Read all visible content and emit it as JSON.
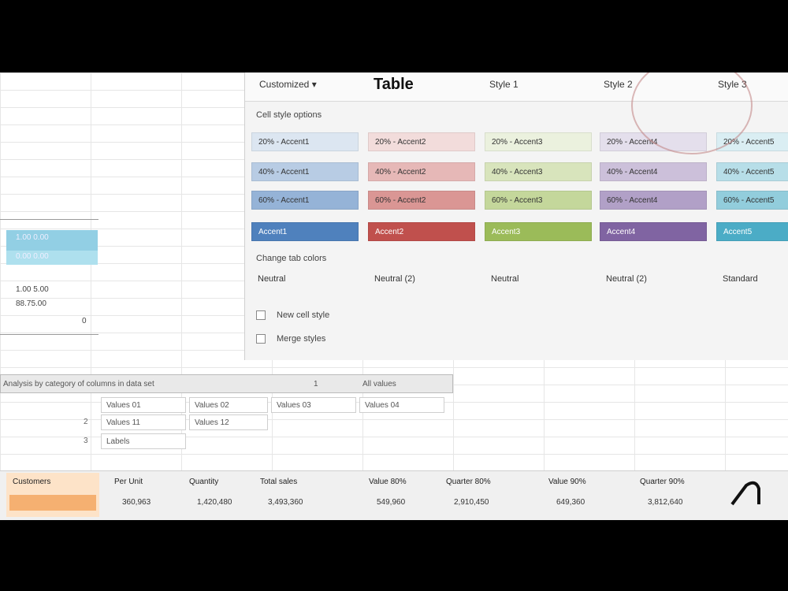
{
  "gallery": {
    "tabs": [
      "Customized ▾",
      "Table",
      "Style 1",
      "Style 2",
      "Style 3"
    ],
    "section1": "Cell style options",
    "section2": "Change tab colors",
    "swatch_rows": [
      [
        "20% - Accent1",
        "20% - Accent2",
        "20% - Accent3",
        "20% - Accent4",
        "20% - Accent5"
      ],
      [
        "40% - Accent1",
        "40% - Accent2",
        "40% - Accent3",
        "40% - Accent4",
        "40% - Accent5"
      ],
      [
        "60% - Accent1",
        "60% - Accent2",
        "60% - Accent3",
        "60% - Accent4",
        "60% - Accent5"
      ],
      [
        "Accent1",
        "Accent2",
        "Accent3",
        "Accent4",
        "Accent5"
      ]
    ],
    "plain_row": [
      "Neutral",
      "Neutral (2)",
      "Neutral",
      "Neutral (2)",
      "Standard"
    ],
    "options": [
      "New cell style",
      "Merge styles"
    ],
    "colors": {
      "r1": [
        "#dce6f1",
        "#f2dcdb",
        "#ebf1de",
        "#e4dfec",
        "#daeef3"
      ],
      "r2": [
        "#b8cce4",
        "#e6b8b7",
        "#d8e4bc",
        "#ccc0da",
        "#b7dee8"
      ],
      "r3": [
        "#95b3d7",
        "#da9694",
        "#c4d79b",
        "#b1a0c7",
        "#92cddc"
      ],
      "r4": [
        "#4f81bd",
        "#c0504d",
        "#9bbb59",
        "#8064a2",
        "#4bacc6"
      ]
    }
  },
  "mini": {
    "lines": [
      "1.00 0.00",
      "0.00 0.00",
      "1.00 5.00",
      "88.75.00",
      "0"
    ]
  },
  "table": {
    "header": [
      "Analysis by category of columns in data set",
      "1",
      "All values"
    ],
    "rows": [
      [
        "Values 01",
        "Values 02",
        "Values 03",
        "Values 04"
      ],
      [
        "Values 11",
        "Values 12"
      ],
      [
        "Labels"
      ]
    ],
    "rownums": [
      "2",
      "3"
    ]
  },
  "bottom": {
    "headers": [
      "Customers",
      "Per Unit",
      "Quantity",
      "Total sales",
      "Value 80%",
      "Quarter 80%",
      "Value 90%",
      "Quarter 90%"
    ],
    "values": [
      "",
      "360,963",
      "1,420,480",
      "3,493,360",
      "549,960",
      "2,910,450",
      "649,360",
      "3,812,640"
    ]
  }
}
